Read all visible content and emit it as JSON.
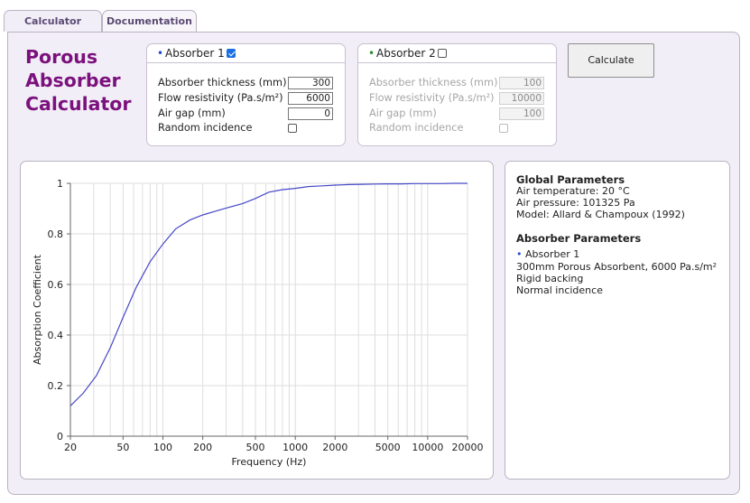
{
  "tabs": [
    {
      "label": "Calculator",
      "active": true
    },
    {
      "label": "Documentation",
      "active": false
    }
  ],
  "app_title": [
    "Porous",
    "Absorber",
    "Calculator"
  ],
  "colors": {
    "title": "#7b117d",
    "curve": "#4448c6",
    "panel": "#f2eef7",
    "dot": "#1a4ad6"
  },
  "absorbers": [
    {
      "label": "Absorber 1",
      "bullet": "•",
      "enabled": true,
      "thickness_label": "Absorber thickness (mm)",
      "thickness": "300",
      "resistivity_label": "Flow resistivity (Pa.s/m²)",
      "resistivity": "6000",
      "airgap_label": "Air gap (mm)",
      "airgap": "0",
      "random_label": "Random incidence",
      "random": false
    },
    {
      "label": "Absorber 2",
      "bullet": "•",
      "enabled": false,
      "thickness_label": "Absorber thickness (mm)",
      "thickness": "100",
      "resistivity_label": "Flow resistivity (Pa.s/m²)",
      "resistivity": "10000",
      "airgap_label": "Air gap (mm)",
      "airgap": "100",
      "random_label": "Random incidence",
      "random": false
    }
  ],
  "calculate_label": "Calculate",
  "chart_data": {
    "type": "line",
    "xlabel": "Frequency (Hz)",
    "ylabel": "Absorption Coefficient",
    "xscale": "log",
    "xlim": [
      20,
      20000
    ],
    "ylim": [
      0,
      1
    ],
    "xticks": [
      20,
      50,
      100,
      200,
      500,
      1000,
      2000,
      5000,
      10000,
      20000
    ],
    "xtick_labels": [
      "20",
      "50",
      "100",
      "200",
      "500",
      "1000",
      "2000",
      "5000",
      "10000",
      "20000"
    ],
    "yticks": [
      0,
      0.2,
      0.4,
      0.6,
      0.8,
      1
    ],
    "ytick_labels": [
      "0",
      "0.2",
      "0.4",
      "0.6",
      "0.8",
      "1"
    ],
    "grid": true,
    "series": [
      {
        "x": [
          20,
          25,
          31.5,
          40,
          50,
          63,
          80,
          100,
          125,
          160,
          200,
          250,
          315,
          400,
          500,
          630,
          800,
          1000,
          1250,
          1600,
          2000,
          2500,
          3150,
          4000,
          5000,
          6300,
          8000,
          10000,
          12500,
          16000,
          20000
        ],
        "y": [
          0.12,
          0.17,
          0.24,
          0.35,
          0.47,
          0.59,
          0.69,
          0.76,
          0.82,
          0.855,
          0.875,
          0.89,
          0.905,
          0.92,
          0.94,
          0.965,
          0.975,
          0.98,
          0.987,
          0.99,
          0.993,
          0.995,
          0.996,
          0.997,
          0.998,
          0.998,
          0.999,
          0.999,
          0.999,
          1.0,
          1.0
        ]
      }
    ]
  },
  "info": {
    "global_heading": "Global Parameters",
    "air_temperature": "Air temperature: 20 °C",
    "air_pressure": "Air pressure: 101325 Pa",
    "model": "Model: Allard & Champoux (1992)",
    "absorber_heading": "Absorber Parameters",
    "absorber_bullet": "•",
    "absorber_name": "Absorber 1",
    "absorber_desc": "300mm Porous Absorbent, 6000 Pa.s/m²",
    "backing": "Rigid backing",
    "incidence": "Normal incidence"
  }
}
